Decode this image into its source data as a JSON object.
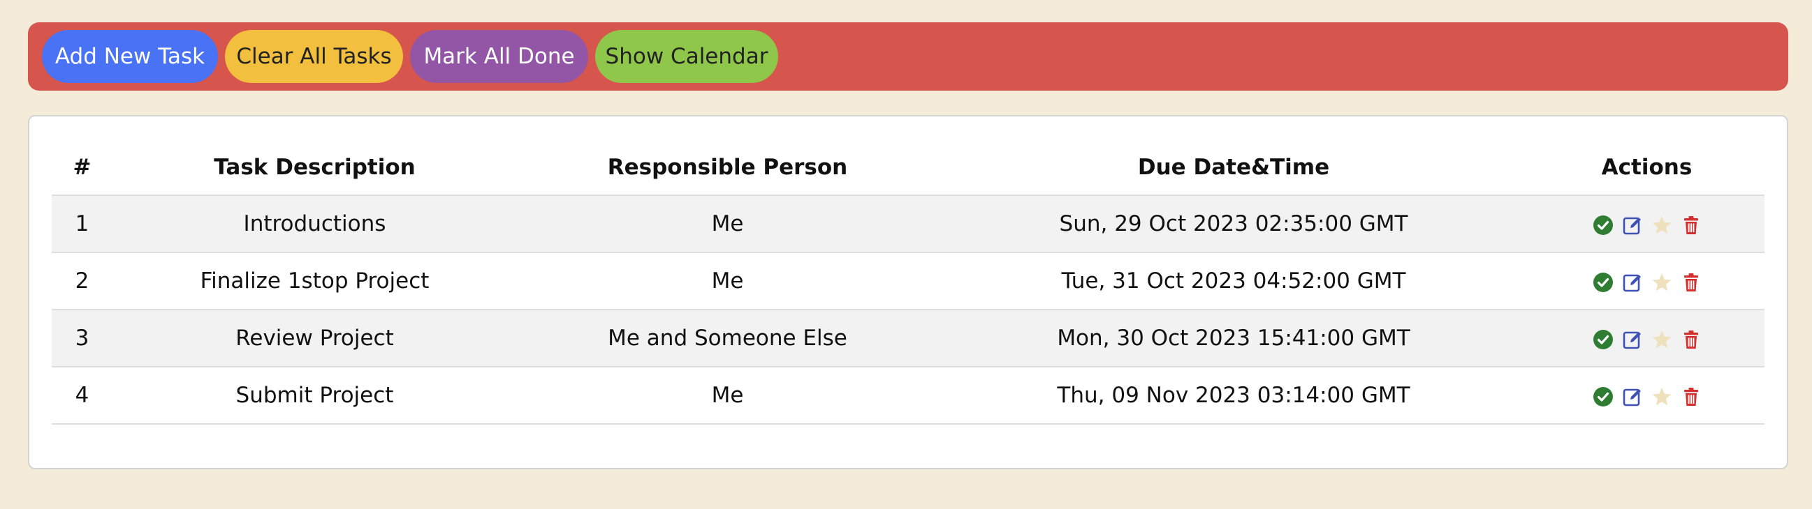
{
  "toolbar": {
    "add_label": "Add New Task",
    "clear_label": "Clear All Tasks",
    "mark_done_label": "Mark All Done",
    "calendar_label": "Show Calendar",
    "colors": {
      "background": "#d6554d",
      "add": "#4a72f4",
      "clear": "#f2c03e",
      "mark_done": "#9356a6",
      "calendar": "#8fc74b"
    }
  },
  "table": {
    "headers": {
      "number": "#",
      "description": "Task Description",
      "person": "Responsible Person",
      "due": "Due Date&Time",
      "actions": "Actions"
    },
    "rows": [
      {
        "number": "1",
        "description": "Introductions",
        "person": "Me",
        "due": "Sun, 29 Oct 2023 02:35:00 GMT"
      },
      {
        "number": "2",
        "description": "Finalize 1stop Project",
        "person": "Me",
        "due": "Tue, 31 Oct 2023 04:52:00 GMT"
      },
      {
        "number": "3",
        "description": "Review Project",
        "person": "Me and Someone Else",
        "due": "Mon, 30 Oct 2023 15:41:00 GMT"
      },
      {
        "number": "4",
        "description": "Submit Project",
        "person": "Me",
        "due": "Thu, 09 Nov 2023 03:14:00 GMT"
      }
    ],
    "row_actions": [
      "check-circle-icon",
      "edit-icon",
      "star-icon",
      "trash-icon"
    ],
    "action_colors": {
      "check": "#2e7d32",
      "edit": "#3f51b5",
      "star": "#efe1bd",
      "trash": "#d32f2f"
    }
  }
}
